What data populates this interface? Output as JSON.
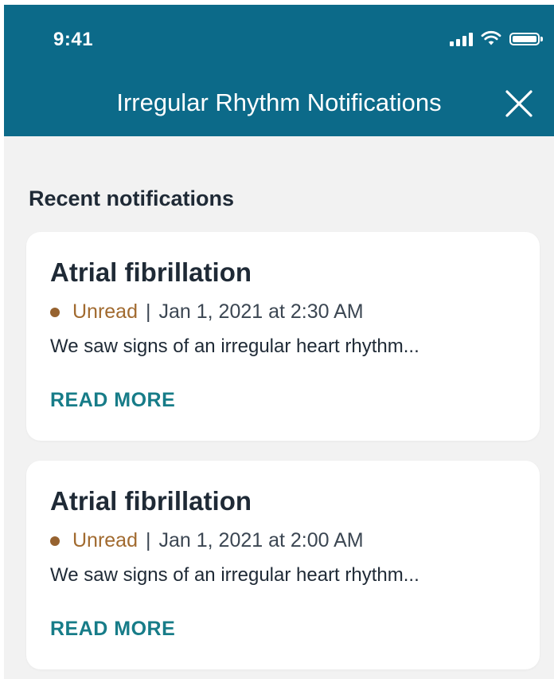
{
  "status_bar": {
    "time": "9:41"
  },
  "header": {
    "title": "Irregular Rhythm Notifications",
    "background_color": "#0c6a89"
  },
  "section": {
    "title": "Recent notifications"
  },
  "notifications": [
    {
      "title": "Atrial fibrillation",
      "status": "Unread",
      "separator": "|",
      "timestamp": "Jan 1, 2021 at 2:30 AM",
      "preview": "We saw signs of an irregular heart rhythm...",
      "action": "READ MORE"
    },
    {
      "title": "Atrial fibrillation",
      "status": "Unread",
      "separator": "|",
      "timestamp": "Jan 1, 2021 at 2:00 AM",
      "preview": "We saw signs of an irregular heart rhythm...",
      "action": "READ MORE"
    }
  ],
  "colors": {
    "accent": "#177c88",
    "unread": "#a16a2f",
    "background": "#f2f2f2"
  },
  "icons": {
    "close": "close-icon",
    "signal": "cellular-signal-icon",
    "wifi": "wifi-icon",
    "battery": "battery-icon"
  }
}
